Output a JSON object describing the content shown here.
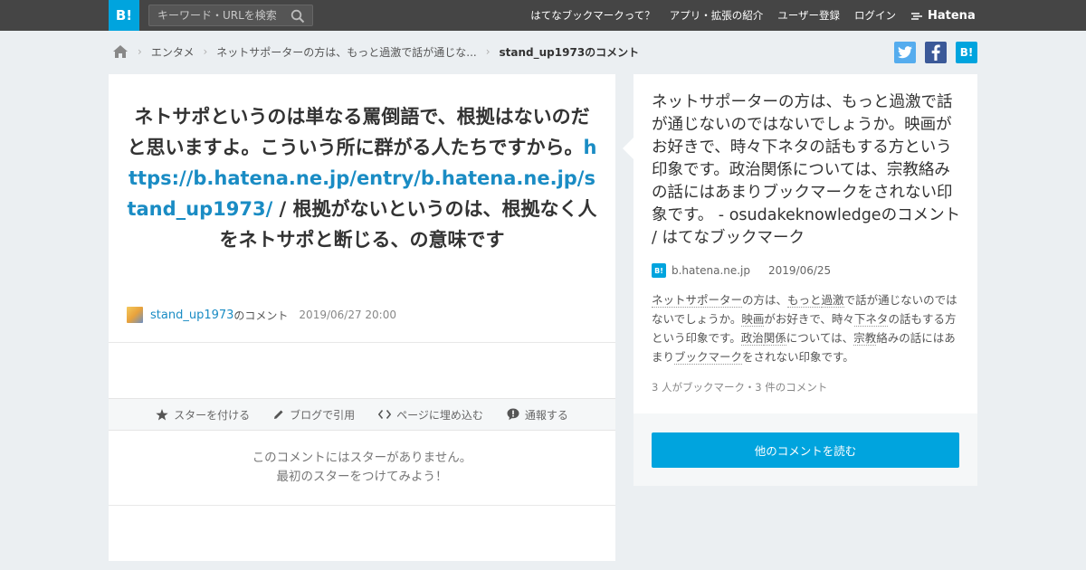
{
  "header": {
    "logo": "B!",
    "search_placeholder": "キーワード・URLを検索",
    "nav": [
      "はてなブックマークって？",
      "アプリ・拡張の紹介",
      "ユーザー登録",
      "ログイン"
    ],
    "brand": "Hatena"
  },
  "breadcrumb": {
    "items": [
      "エンタメ",
      "ネットサポーターの方は、もっと過激で話が通じな..."
    ],
    "current": "stand_up1973のコメント"
  },
  "share": {
    "twitter": "t",
    "facebook": "f",
    "hatebu": "B!"
  },
  "comment": {
    "text_before": "ネトサポというのは単なる罵倒語で、根拠はないのだと思いますよ。こういう所に群がる人たちですから。",
    "link": "https://b.hatena.ne.jp/entry/b.hatena.ne.jp/stand_up1973/",
    "text_after": " / 根拠がないというのは、根拠なく人をネトサポと断じる、の意味です",
    "user": "stand_up1973",
    "user_suffix": "のコメント",
    "datetime": "2019/06/27 20:00"
  },
  "actions": {
    "star": "スターを付ける",
    "blog": "ブログで引用",
    "embed": "ページに埋め込む",
    "report": "通報する"
  },
  "no_star": {
    "line1": "このコメントにはスターがありません。",
    "line2": "最初のスターをつけてみよう！"
  },
  "entry": {
    "title": "ネットサポーターの方は、もっと過激で話が通じないのではないでしょうか。映画がお好きで、時々下ネタの話もする方という印象です。政治関係については、宗教絡みの話にはあまりブックマークをされない印象です。 - osudakeknowledgeのコメント / はてなブックマーク",
    "favicon": "B!",
    "domain": "b.hatena.ne.jp",
    "date": "2019/06/25",
    "desc": [
      {
        "t": "ネットサポーター",
        "kw": true
      },
      {
        "t": "の方は、",
        "kw": false
      },
      {
        "t": "もっと",
        "kw": true
      },
      {
        "t": "過激",
        "kw": true
      },
      {
        "t": "で話が通じないのではないでしょうか。",
        "kw": false
      },
      {
        "t": "映画",
        "kw": true
      },
      {
        "t": "がお好きで、時々",
        "kw": false
      },
      {
        "t": "下ネタ",
        "kw": true
      },
      {
        "t": "の話もする方という印象です。",
        "kw": false
      },
      {
        "t": "政治",
        "kw": true
      },
      {
        "t": "関係",
        "kw": true
      },
      {
        "t": "については、",
        "kw": false
      },
      {
        "t": "宗教",
        "kw": true
      },
      {
        "t": "絡みの話にはあまり",
        "kw": false
      },
      {
        "t": "ブックマーク",
        "kw": true
      },
      {
        "t": "をされない印象です。",
        "kw": false
      }
    ],
    "counts": "3 人がブックマーク・3 件のコメント"
  },
  "more_button": "他のコメントを読む",
  "colors": {
    "accent": "#00a4de",
    "link": "#1a8cc4",
    "header": "#454545",
    "background": "#ebeff2"
  }
}
